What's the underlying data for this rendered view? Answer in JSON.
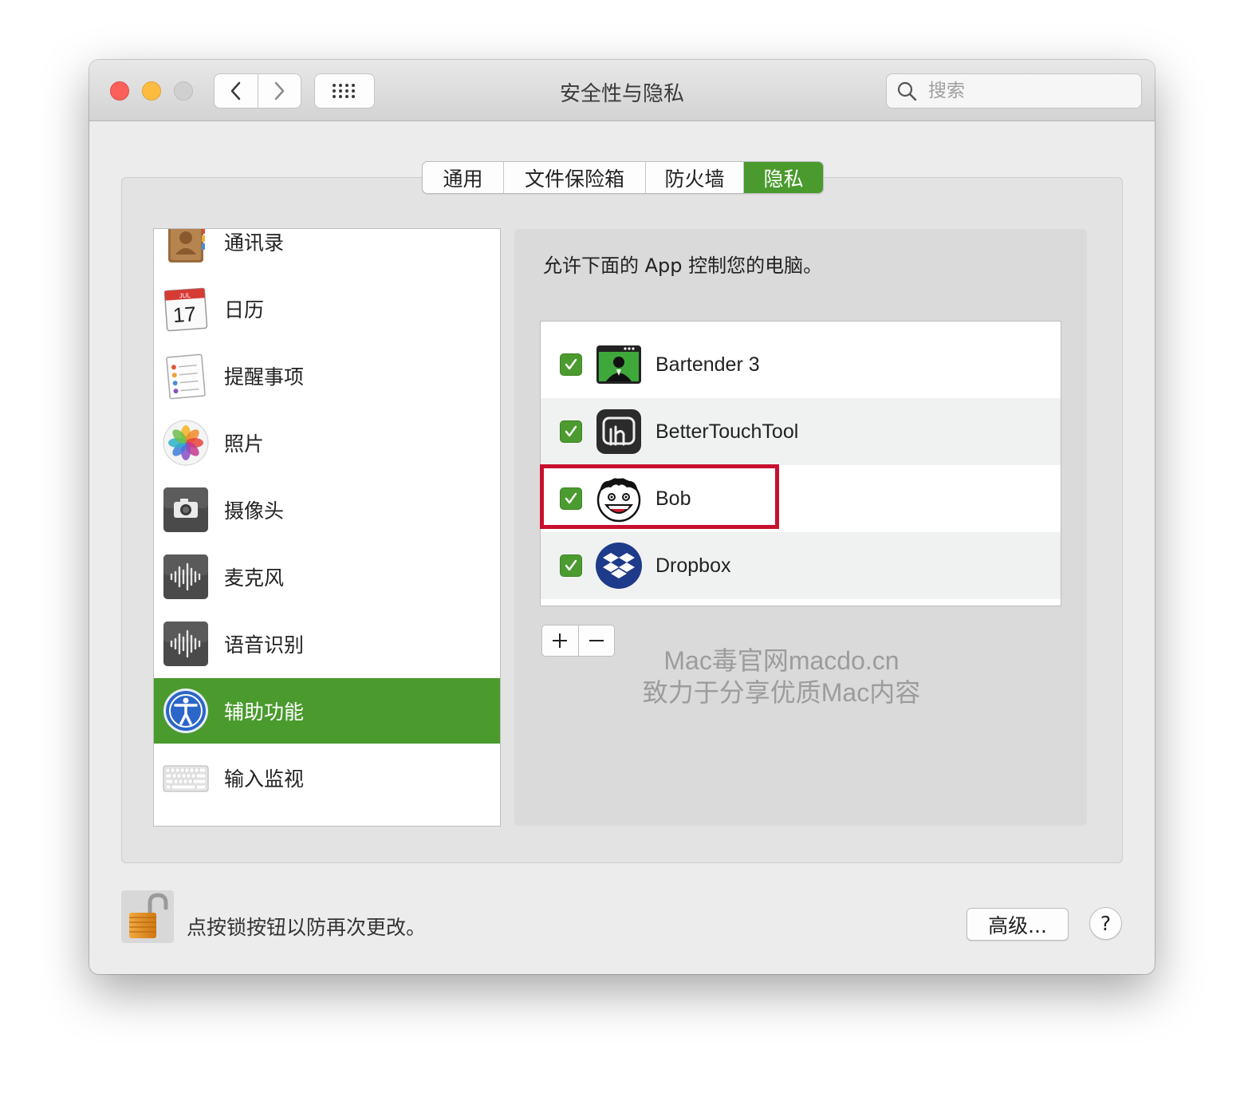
{
  "window": {
    "title": "安全性与隐私",
    "search_placeholder": "搜索"
  },
  "tabs": [
    {
      "label": "通用",
      "active": false
    },
    {
      "label": "文件保险箱",
      "active": false
    },
    {
      "label": "防火墙",
      "active": false
    },
    {
      "label": "隐私",
      "active": true
    }
  ],
  "sidebar": {
    "items": [
      {
        "label": "通讯录",
        "icon": "contacts-icon",
        "selected": false
      },
      {
        "label": "日历",
        "icon": "calendar-icon",
        "selected": false,
        "icon_month": "JUL",
        "icon_day": "17"
      },
      {
        "label": "提醒事项",
        "icon": "reminders-icon",
        "selected": false
      },
      {
        "label": "照片",
        "icon": "photos-icon",
        "selected": false
      },
      {
        "label": "摄像头",
        "icon": "camera-icon",
        "selected": false
      },
      {
        "label": "麦克风",
        "icon": "microphone-icon",
        "selected": false
      },
      {
        "label": "语音识别",
        "icon": "speech-recognition-icon",
        "selected": false
      },
      {
        "label": "辅助功能",
        "icon": "accessibility-icon",
        "selected": true
      },
      {
        "label": "输入监视",
        "icon": "keyboard-icon",
        "selected": false
      }
    ]
  },
  "main": {
    "prompt": "允许下面的 App 控制您的电脑。",
    "apps": [
      {
        "name": "Bartender 3",
        "checked": true,
        "icon": "bartender-icon"
      },
      {
        "name": "BetterTouchTool",
        "checked": true,
        "icon": "bettertouchtool-icon"
      },
      {
        "name": "Bob",
        "checked": true,
        "icon": "bob-icon",
        "highlighted": true
      },
      {
        "name": "Dropbox",
        "checked": true,
        "icon": "dropbox-icon"
      }
    ],
    "add_label": "+",
    "remove_label": "−"
  },
  "watermark": {
    "line1": "Mac毒官网macdo.cn",
    "line2": "致力于分享优质Mac内容"
  },
  "footer": {
    "lock_text": "点按锁按钮以防再次更改。",
    "advanced_label": "高级...",
    "help_label": "?"
  },
  "colors": {
    "accent_green": "#4a9a2e",
    "highlight_red": "#c8102e"
  }
}
